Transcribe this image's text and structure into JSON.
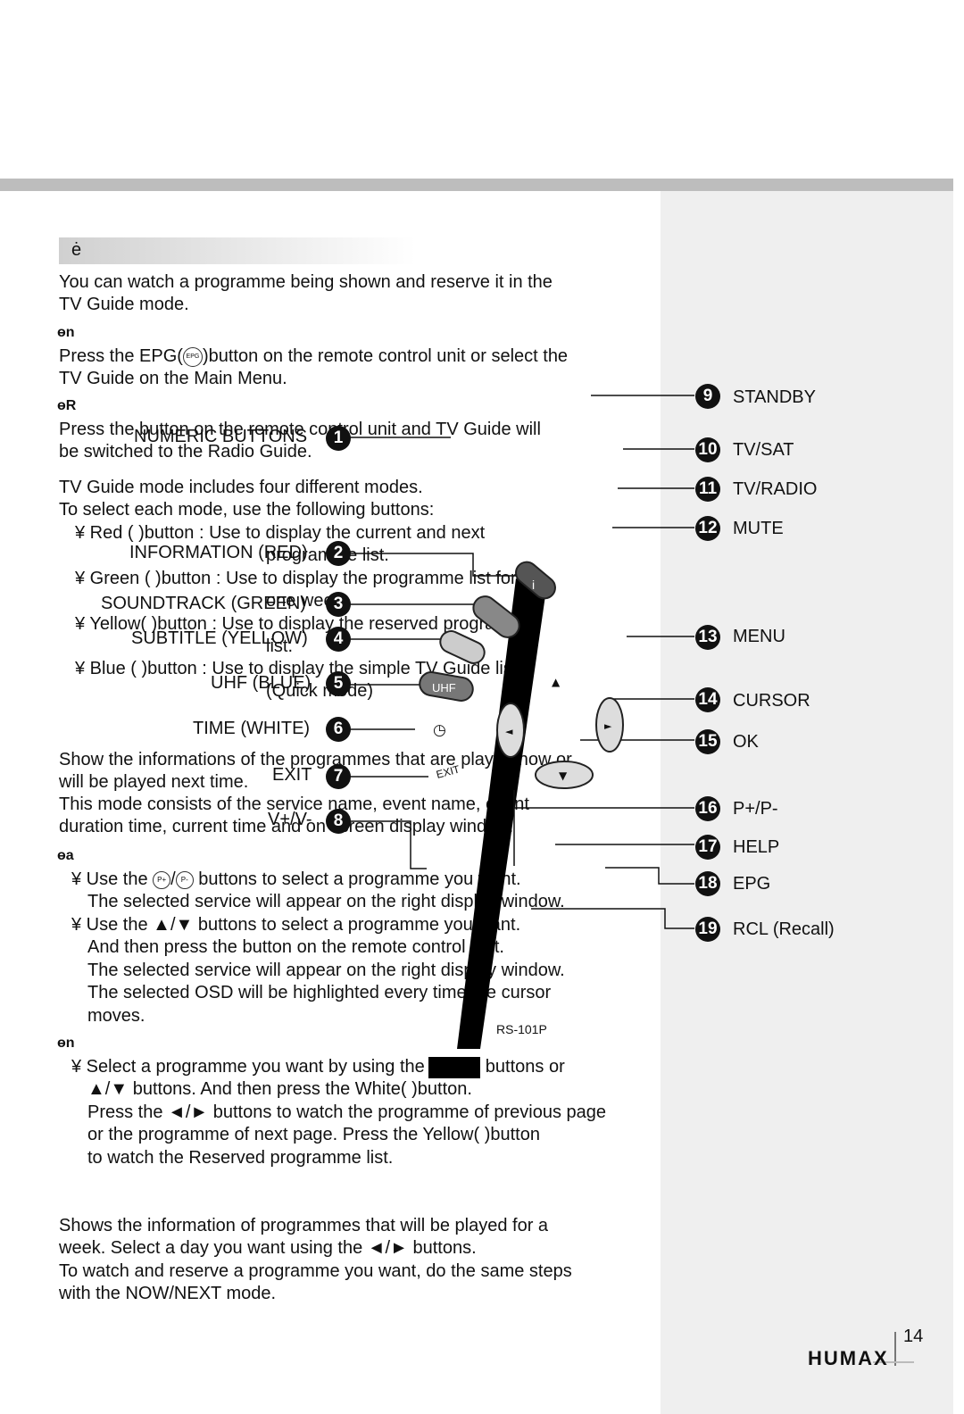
{
  "section_heading": "ė",
  "intro": [
    "You can watch a programme being shown and reserve it in the",
    "TV Guide mode."
  ],
  "sub1_heading": "ɵn",
  "sub1": [
    "Press the EPG(",
    ")button on the remote control unit or select the",
    "TV Guide on the Main Menu."
  ],
  "epg_icon": "EPG",
  "sub2_heading": "ɵR",
  "sub2": [
    "Press the       button on the remote control unit and TV Guide will",
    "be switched to the Radio Guide."
  ],
  "modes_intro": [
    "TV Guide mode includes four different modes.",
    "To select each mode, use the following buttons:"
  ],
  "modes": [
    {
      "line1": "¥ Red   (       )button : Use to display the current and next",
      "line2": "programme list."
    },
    {
      "line1": "¥ Green (       )button : Use to display the programme list for",
      "line2": "one week."
    },
    {
      "line1": "¥ Yellow(       )button : Use to display the reserved programme",
      "line2": "list."
    },
    {
      "line1": "¥ Blue   (       )button : Use to display the simple TV Guide list.",
      "line2": "(Quick mode)"
    }
  ],
  "nownext": [
    "Show the informations of the programmes that are played now or",
    "will be played next time.",
    "This mode consists of the service name, event name, event",
    "duration time, current time and on screen display window."
  ],
  "sub3_heading": "ɵa",
  "sub3": [
    "¥  Use the",
    "buttons to select a programme you want.",
    "The selected service will appear on the right display window.",
    "¥  Use the ▲/▼ buttons to select a programme you want.",
    "And then press the       button on the remote control unit.",
    "The selected service will appear on the right display window.",
    "The selected OSD will be highlighted every time the cursor",
    "moves."
  ],
  "pbutton_icons": [
    "P+",
    "P-"
  ],
  "sub4_heading": "ɵn",
  "sub4": [
    "¥  Select a programme you want by using the",
    "buttons or",
    "▲/▼ buttons. And then press the White(       )button.",
    "Press the ◄/► buttons to watch the programme of previous page",
    "or the programme of next page. Press the Yellow(       )button",
    "to watch the Reserved programme list."
  ],
  "weekly": [
    "Shows the information of programmes that will be played for a",
    "week. Select a day you want using the ◄/► buttons.",
    "To watch and reserve a programme you want, do the same steps",
    "with the NOW/NEXT mode."
  ],
  "remote_left_labels": [
    {
      "n": "1",
      "label": "NUMERIC BUTTONS"
    },
    {
      "n": "2",
      "label": "INFORMATION (RED)"
    },
    {
      "n": "3",
      "label": "SOUNDTRACK (GREEN)"
    },
    {
      "n": "4",
      "label": "SUBTITLE (YELLOW)"
    },
    {
      "n": "5",
      "label": "UHF (BLUE)"
    },
    {
      "n": "6",
      "label": "TIME (WHITE)"
    },
    {
      "n": "7",
      "label": "EXIT"
    },
    {
      "n": "8",
      "label": "V+/V-"
    }
  ],
  "remote_right_labels": [
    {
      "n": "9",
      "label": "STANDBY"
    },
    {
      "n": "10",
      "label": "TV/SAT"
    },
    {
      "n": "11",
      "label": "TV/RADIO"
    },
    {
      "n": "12",
      "label": "MUTE"
    },
    {
      "n": "13",
      "label": "MENU"
    },
    {
      "n": "14",
      "label": "CURSOR"
    },
    {
      "n": "15",
      "label": "OK"
    },
    {
      "n": "16",
      "label": "P+/P-"
    },
    {
      "n": "17",
      "label": "HELP"
    },
    {
      "n": "18",
      "label": "EPG"
    },
    {
      "n": "19",
      "label": "RCL (Recall)"
    }
  ],
  "remote_buttons": {
    "info": "i",
    "uhf": "UHF",
    "exit": "EXIT",
    "time": "◷",
    "left": "◄",
    "right": "►",
    "down": "▼",
    "up": "▲"
  },
  "remote_model": "RS-101P",
  "page_number": "14",
  "logo": "HUMAX",
  "colors": {
    "top_bar": "#bdbdbd",
    "side_panel": "#efefef"
  }
}
